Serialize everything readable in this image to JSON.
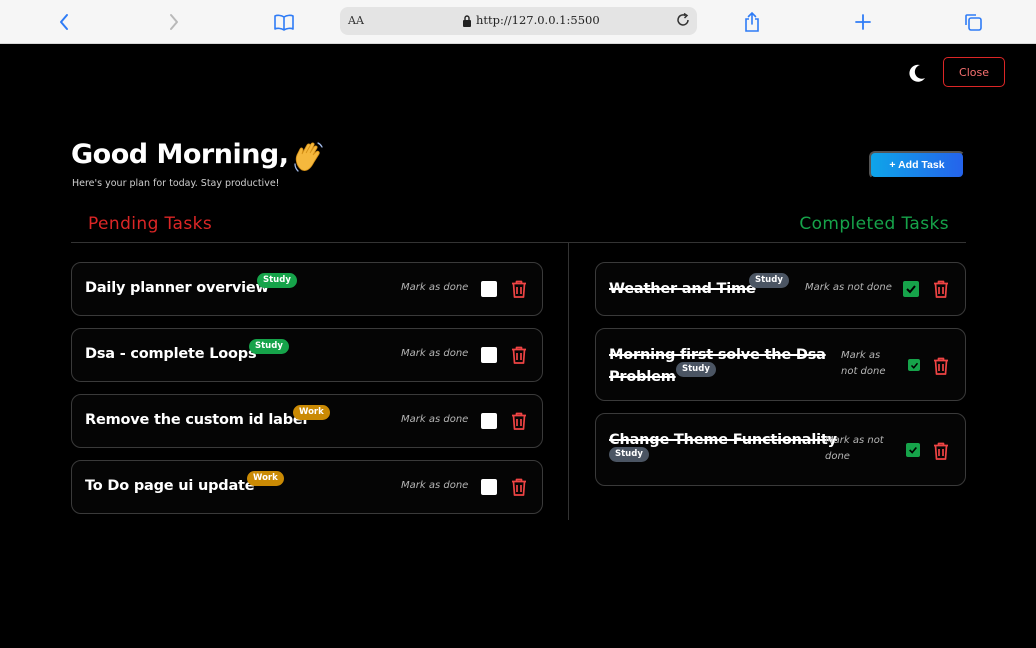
{
  "browser": {
    "text_size_label": "AA",
    "url": "http://127.0.0.1:5500"
  },
  "header": {
    "close_label": "Close",
    "greeting": "Good Morning,",
    "subtitle": "Here's your plan for today. Stay productive!",
    "add_task_label": "+ Add Task"
  },
  "sections": {
    "pending_title": "Pending Tasks",
    "completed_title": "Completed Tasks"
  },
  "pending_tasks": [
    {
      "title": "Daily planner overview",
      "tag": "Study",
      "action": "Mark as done"
    },
    {
      "title": "Dsa - complete Loops",
      "tag": "Study",
      "action": "Mark as done"
    },
    {
      "title": "Remove the custom id label",
      "tag": "Work",
      "action": "Mark as done"
    },
    {
      "title": "To Do page ui update",
      "tag": "Work",
      "action": "Mark as done"
    }
  ],
  "completed_tasks": [
    {
      "title_line1": "Weather and Time",
      "tag": "Study",
      "action": "Mark as not done"
    },
    {
      "title_line1": "Morning first solve the Dsa",
      "title_line2": "Problem",
      "tag": "Study",
      "action_line1": "Mark as",
      "action_line2": "not done"
    },
    {
      "title_line1": "Change Theme Functionality",
      "tag": "Study",
      "action_line1": "Mark as not",
      "action_line2": "done"
    }
  ],
  "colors": {
    "pending": "#dc2626",
    "completed": "#16a34a",
    "study_tag": "#16a34a",
    "work_tag": "#ca8a04",
    "done_tag": "#4b5563",
    "trash": "#ef4444"
  }
}
